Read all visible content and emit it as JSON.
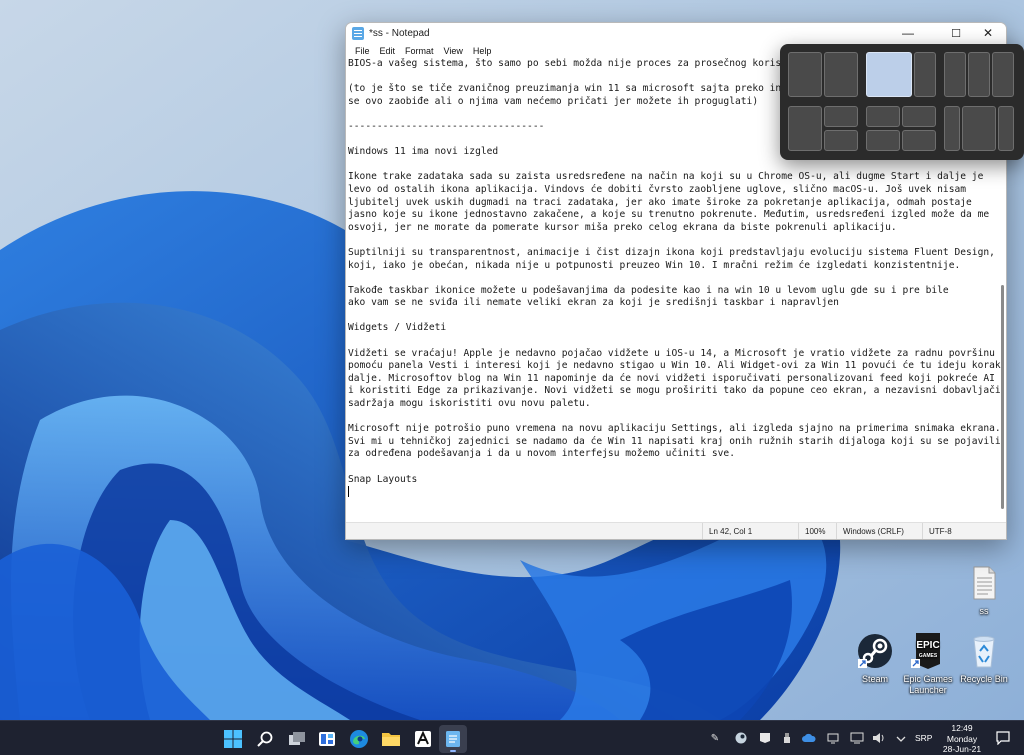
{
  "window": {
    "title": "*ss - Notepad",
    "controls": {
      "minimize": "—",
      "maximize": "☐",
      "close": "✕"
    }
  },
  "menu": [
    "File",
    "Edit",
    "Format",
    "View",
    "Help"
  ],
  "document_lines": [
    "BIOS-a vašeg sistema, što samo po sebi možda nije proces za prosečnog korisn",
    "",
    "(to je što se tiče zvaničnog preuzimanja win 11 sa microsoft sajta preko ins",
    "se ovo zaobiđe ali o njima vam nećemo pričati jer možete ih proguglati)",
    "",
    "----------------------------------",
    "",
    "Windows 11 ima novi izgled",
    "",
    "Ikone trake zadataka sada su zaista usredsređene na način na koji su u Chrome OS-u, ali dugme Start i dalje je",
    "levo od ostalih ikona aplikacija. Vindovs će dobiti čvrsto zaobljene uglove, slično macOS-u. Još uvek nisam",
    "ljubitelj uvek uskih dugmadi na traci zadataka, jer ako imate široke za pokretanje aplikacija, odmah postaje",
    "jasno koje su ikone jednostavno zakačene, a koje su trenutno pokrenute. Međutim, usredsređeni izgled može da me",
    "osvoji, jer ne morate da pomerate kursor miša preko celog ekrana da biste pokrenuli aplikaciju.",
    "",
    "Suptilniji su transparentnost, animacije i čist dizajn ikona koji predstavljaju evoluciju sistema Fluent Design,",
    "koji, iako je obećan, nikada nije u potpunosti preuzeo Win 10. I mračni režim će izgledati konzistentnije.",
    "",
    "Takođe taskbar ikonice možete u podešavanjima da podesite kao i na win 10 u levom uglu gde su i pre bile",
    "ako vam se ne sviđa ili nemate veliki ekran za koji je središnji taskbar i napravljen",
    "",
    "Widgets / Vidžeti",
    "",
    "Vidžeti se vraćaju! Apple je nedavno pojačao vidžete u iOS-u 14, a Microsoft je vratio vidžete za radnu površinu",
    "pomoću panela Vesti i interesi koji je nedavno stigao u Win 10. Ali Widget-ovi za Win 11 povući će tu ideju korak",
    "dalje. Microsoftov blog na Win 11 napominje da će novi vidžeti isporučivati personalizovani feed koji pokreće AI",
    "i koristiti Edge za prikazivanje. Novi vidžeti se mogu proširiti tako da popune ceo ekran, a nezavisni dobavljači",
    "sadržaja mogu iskoristiti ovu novu paletu.",
    "",
    "Microsoft nije potrošio puno vremena na novu aplikaciju Settings, ali izgleda sjajno na primerima snimaka ekrana.",
    "Svi mi u tehničkoj zajednici se nadamo da će Win 11 napisati kraj onih ružnih starih dijaloga koji su se pojavili",
    "za određena podešavanja i da u novom interfejsu možemo učiniti sve.",
    "",
    "Snap Layouts",
    ""
  ],
  "status": {
    "position": "Ln 42, Col 1",
    "zoom": "100%",
    "line_endings": "Windows (CRLF)",
    "encoding": "UTF-8"
  },
  "desktop_icons": {
    "file": "ss",
    "steam": "Steam",
    "epic": "Epic Games Launcher",
    "recycle": "Recycle Bin"
  },
  "epic_logo_text": "EPIC GAMES",
  "snap_layouts": {
    "hovered_layout": "two-column-wide-left",
    "hovered_zone": "left"
  },
  "taskbar": {
    "apps": [
      "start-icon",
      "search-icon",
      "task-view-icon",
      "widgets-icon",
      "edge-icon",
      "file-explorer-icon",
      "store-icon",
      "app-icon",
      "notepad-icon"
    ],
    "active_app": "notepad-icon",
    "tray": [
      "pen-icon",
      "steam-tray-icon",
      "epic-tray-icon",
      "usb-icon",
      "cloud-icon",
      "display-icon",
      "network-icon",
      "volume-icon"
    ],
    "language": "SRP",
    "time": "12:49",
    "day": "Monday",
    "date": "28-Jun-21"
  }
}
